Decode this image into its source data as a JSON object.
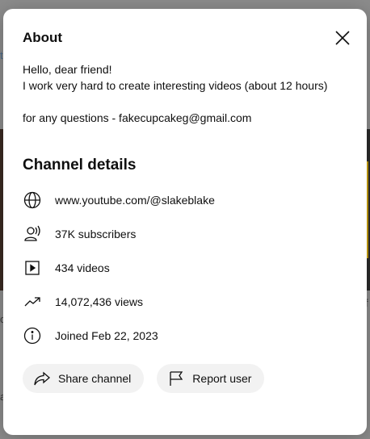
{
  "dialog": {
    "title": "About",
    "description_lines": [
      "Hello, dear friend!",
      "I work very hard to create interesting videos (about 12 hours)",
      "for any questions - fakecupcakeg@gmail.com"
    ]
  },
  "details": {
    "title": "Channel details",
    "url": "www.youtube.com/@slakeblake",
    "subscribers": "37K subscribers",
    "videos": "434 videos",
    "views": "14,072,436 views",
    "joined": "Joined Feb 22, 2023"
  },
  "actions": {
    "share_label": "Share channel",
    "report_label": "Report user"
  },
  "icons": {
    "close": "close-icon",
    "globe": "globe-icon",
    "subscribers": "person-broadcast-icon",
    "videos": "play-square-icon",
    "views": "trending-up-icon",
    "joined": "info-icon",
    "share": "share-icon",
    "report": "flag-icon"
  },
  "background": {
    "letters": [
      "t",
      "o",
      "f",
      "a"
    ]
  }
}
